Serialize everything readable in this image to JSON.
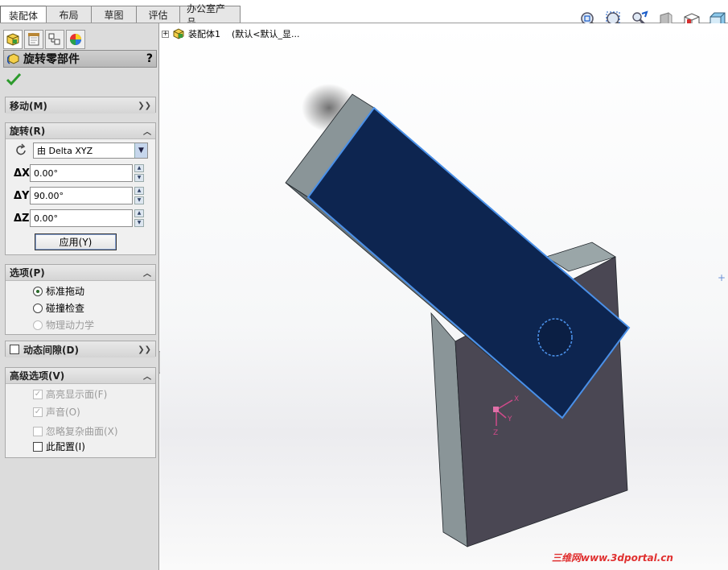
{
  "tabs": [
    {
      "label": "装配体",
      "active": true
    },
    {
      "label": "布局",
      "active": false
    },
    {
      "label": "草图",
      "active": false
    },
    {
      "label": "评估",
      "active": false
    },
    {
      "label": "办公室产品",
      "active": false
    }
  ],
  "view_toolbar": [
    "zoom-to-fit-icon",
    "zoom-to-area-icon",
    "previous-view-icon",
    "section-view-icon",
    "view-orientation-icon",
    "display-style-icon"
  ],
  "panel": {
    "tab_icons": [
      "feature-manager-icon",
      "property-manager-icon",
      "configuration-manager-icon",
      "appearance-manager-icon"
    ],
    "title": "旋转零部件",
    "help": "?",
    "move_group": {
      "label": "移动(M)"
    },
    "rotate_group": {
      "label": "旋转(R)",
      "mode": "由 Delta XYZ",
      "dx_label": "ΔX",
      "dx": "0.00°",
      "dy_label": "ΔY",
      "dy": "90.00°",
      "dz_label": "ΔZ",
      "dz": "0.00°",
      "apply": "应用(Y)"
    },
    "options_group": {
      "label": "选项(P)",
      "standard_drag": "标准拖动",
      "collision_check": "碰撞检查",
      "physical_dynamics": "物理动力学"
    },
    "dynamic_clearance": {
      "label": "动态间隙(D)"
    },
    "advanced_group": {
      "label": "高级选项(V)",
      "highlight_faces": "高亮显示面(F)",
      "sound": "声音(O)",
      "ignore_complex": "忽略复杂曲面(X)",
      "this_config": "此配置(I)"
    }
  },
  "tree": {
    "assembly": "装配体1",
    "config": "(默认<默认_显..."
  },
  "triad": {
    "x": "X",
    "y": "Y",
    "z": "Z"
  },
  "watermark": "三维网www.3dportal.cn",
  "colors": {
    "selected_face": "#0d2550",
    "edge_highlight": "#4a90e8",
    "body_dark": "#4a4753",
    "body_side": "#8a9598"
  }
}
